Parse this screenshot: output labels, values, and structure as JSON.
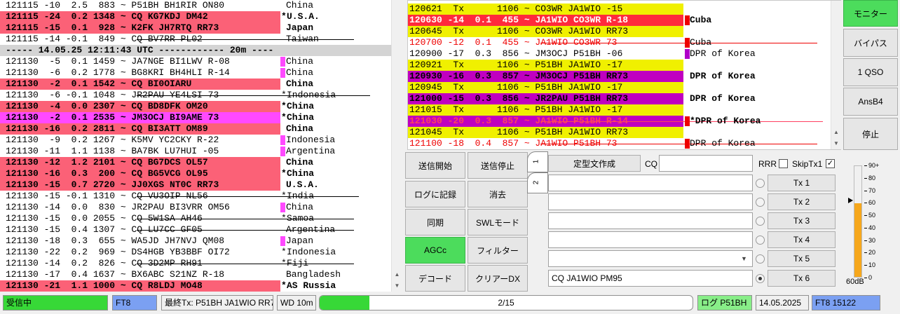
{
  "colors": {
    "cq_row": "#fb6177",
    "my_call_row": "#ff49ff",
    "tx_row": "#f0f000",
    "reply_row": "#ff2a3c",
    "dx_row": "#c000c0",
    "marker_pink": "#ff49ff",
    "marker_red": "#ee0000",
    "marker_purple": "#b000c8",
    "accent_green": "#4cdc5c"
  },
  "left_rows": [
    {
      "text": "121115 -10  2.5  883 ~ P51BH BH1RIR ON80",
      "country": "China",
      "bg": "",
      "marker": "",
      "star": "",
      "bold": false,
      "strike": false
    },
    {
      "text": "121115 -24  0.2 1348 ~ CQ KG7KDJ DM42",
      "country": "U.S.A.",
      "bg": "cq_row",
      "marker": "",
      "star": "*",
      "bold": true,
      "strike": false
    },
    {
      "text": "121115 -15  0.1  928 ~ K2FK JH7RTQ RR73",
      "country": "Japan",
      "bg": "cq_row",
      "marker": "",
      "star": "",
      "bold": true,
      "strike": false
    },
    {
      "text": "121115 -14 -0.1  849 ~ CQ BV7RR PL02",
      "country": "Taiwan",
      "bg": "",
      "marker": "",
      "star": "",
      "bold": false,
      "strike": true,
      "strike_start": 24,
      "strike_len": 13
    },
    {
      "text": "----- 14.05.25 12:11:43 UTC ------------ 20m ----",
      "country": "",
      "bg": "",
      "marker": "",
      "star": "",
      "bold": true,
      "strike": false,
      "sep": true
    },
    {
      "text": "121130  -5  0.1 1459 ~ JA7NGE BI1LWV R-08",
      "country": "China",
      "bg": "",
      "marker": "marker_pink",
      "star": "",
      "bold": false,
      "strike": false
    },
    {
      "text": "121130  -6  0.2 1778 ~ BG8KRI BH4HLI R-14",
      "country": "China",
      "bg": "",
      "marker": "marker_pink",
      "star": "",
      "bold": false,
      "strike": false
    },
    {
      "text": "121130  -2  0.1 1542 ~ CQ BI0OIARU",
      "country": "China",
      "bg": "cq_row",
      "marker": "",
      "star": "",
      "bold": true,
      "strike": false
    },
    {
      "text": "121130  -6 -0.1 1048 ~ JR2PAU YE4LSI 73",
      "country": "Indonesia",
      "bg": "",
      "marker": "",
      "star": "*",
      "bold": false,
      "strike": true,
      "strike_start": 24,
      "strike_len": 16
    },
    {
      "text": "121130  -4  0.0 2307 ~ CQ BD8DFK OM20",
      "country": "China",
      "bg": "cq_row",
      "marker": "",
      "star": "*",
      "bold": true,
      "strike": false
    },
    {
      "text": "121130  -2  0.1 2535 ~ JM3OCJ BI9AME 73",
      "country": "China",
      "bg": "my_call_row",
      "marker": "",
      "star": "*",
      "bold": true,
      "strike": false
    },
    {
      "text": "121130 -16  0.2 2811 ~ CQ BI3ATT OM89",
      "country": "China",
      "bg": "cq_row",
      "marker": "",
      "star": "",
      "bold": true,
      "strike": false
    },
    {
      "text": "121130  -9  0.2 1267 ~ K5MV YC2CKY R-22",
      "country": "Indonesia",
      "bg": "",
      "marker": "marker_pink",
      "star": "",
      "bold": false,
      "strike": false
    },
    {
      "text": "121130 -11  1.1 1138 ~ BA7BK LU7HUI -05",
      "country": "Argentina",
      "bg": "",
      "marker": "marker_pink",
      "star": "",
      "bold": false,
      "strike": false
    },
    {
      "text": "121130 -12  1.2 2101 ~ CQ BG7DCS OL57",
      "country": "China",
      "bg": "cq_row",
      "marker": "",
      "star": "",
      "bold": true,
      "strike": false
    },
    {
      "text": "121130 -16  0.3  200 ~ CQ BG5VCG OL95",
      "country": "China",
      "bg": "cq_row",
      "marker": "",
      "star": "*",
      "bold": true,
      "strike": false
    },
    {
      "text": "121130 -15  0.7 2720 ~ JJ0XGS NT0C RR73",
      "country": "U.S.A.",
      "bg": "cq_row",
      "marker": "",
      "star": "",
      "bold": true,
      "strike": false
    },
    {
      "text": "121130 -15 -0.1 1310 ~ CQ VU3OIP NL56",
      "country": "India",
      "bg": "",
      "marker": "",
      "star": "*",
      "bold": false,
      "strike": true,
      "strike_start": 24,
      "strike_len": 14
    },
    {
      "text": "121130 -14  0.0  830 ~ JR2PAU BI3VRR OM56",
      "country": "China",
      "bg": "",
      "marker": "marker_pink",
      "star": "",
      "bold": false,
      "strike": false
    },
    {
      "text": "121130 -15  0.0 2055 ~ CQ 5W1SA AH46",
      "country": "Samoa",
      "bg": "",
      "marker": "",
      "star": "*",
      "bold": false,
      "strike": true,
      "strike_start": 24,
      "strike_len": 13
    },
    {
      "text": "121130 -15  0.4 1307 ~ CQ LU7CC GF05",
      "country": "Argentina",
      "bg": "",
      "marker": "",
      "star": "",
      "bold": false,
      "strike": true,
      "strike_start": 24,
      "strike_len": 13
    },
    {
      "text": "121130 -18  0.3  655 ~ WA5JD JH7NVJ QM08",
      "country": "Japan",
      "bg": "",
      "marker": "marker_pink",
      "star": "",
      "bold": false,
      "strike": false
    },
    {
      "text": "121130 -22  0.2  969 ~ DS4HGB YB3BBF OI72",
      "country": "Indonesia",
      "bg": "",
      "marker": "",
      "star": "*",
      "bold": false,
      "strike": false
    },
    {
      "text": "121130 -14  0.2  826 ~ CQ 3D2MP RH91",
      "country": "Fiji",
      "bg": "",
      "marker": "",
      "star": "*",
      "bold": false,
      "strike": true,
      "strike_start": 24,
      "strike_len": 13
    },
    {
      "text": "121130 -17  0.4 1637 ~ BX6ABC S21NZ R-18",
      "country": "Bangladesh",
      "bg": "",
      "marker": "",
      "star": "",
      "bold": false,
      "strike": false
    },
    {
      "text": "121130 -21  1.1 1000 ~ CQ R8LDJ MO48",
      "country": "AS Russia",
      "bg": "cq_row",
      "marker": "",
      "star": "*",
      "bold": true,
      "strike": false
    }
  ],
  "rx_rows": [
    {
      "text": "120621  Tx      1106 ~ CO3WR JA1WIO -15",
      "country": "",
      "bg": "tx_row",
      "color": "#000",
      "marker": "",
      "bold": false,
      "strike": false
    },
    {
      "text": "120630 -14  0.1  455 ~ JA1WIO CO3WR R-18",
      "country": "Cuba",
      "bg": "reply_row",
      "color": "#fff",
      "marker": "marker_red",
      "bold": true,
      "strike": false
    },
    {
      "text": "120645  Tx      1106 ~ CO3WR JA1WIO RR73",
      "country": "",
      "bg": "tx_row",
      "color": "#000",
      "marker": "",
      "bold": false,
      "strike": false
    },
    {
      "text": "120700 -12  0.1  455 ~ JA1WIO CO3WR 73",
      "country": "Cuba",
      "bg": "",
      "color": "#ee0000",
      "marker": "marker_red",
      "bold": false,
      "strike": true,
      "strike_start": 24,
      "strike_len": 16
    },
    {
      "text": "120900 -17  0.3  856 ~ JM3OCJ P51BH -06",
      "country": "DPR of Korea",
      "bg": "",
      "color": "#000",
      "marker": "marker_purple",
      "bold": false,
      "strike": false
    },
    {
      "text": "120921  Tx      1106 ~ P51BH JA1WIO -17",
      "country": "",
      "bg": "tx_row",
      "color": "#000",
      "marker": "",
      "bold": false,
      "strike": false
    },
    {
      "text": "120930 -16  0.3  857 ~ JM3OCJ P51BH RR73",
      "country": "DPR of Korea",
      "bg": "dx_row",
      "color": "#000",
      "marker": "",
      "bold": true,
      "strike": false
    },
    {
      "text": "120945  Tx      1106 ~ P51BH JA1WIO -17",
      "country": "",
      "bg": "tx_row",
      "color": "#000",
      "marker": "",
      "bold": false,
      "strike": false
    },
    {
      "text": "121000 -15  0.3  856 ~ JR2PAU P51BH RR73",
      "country": "DPR of Korea",
      "bg": "dx_row",
      "color": "#000",
      "marker": "",
      "bold": true,
      "strike": false
    },
    {
      "text": "121015  Tx      1106 ~ P51BH JA1WIO -17",
      "country": "",
      "bg": "tx_row",
      "color": "#000",
      "marker": "",
      "bold": false,
      "strike": false
    },
    {
      "text": "121030 -20  0.3  857 ~ JA1WIO P51BH R-14",
      "country": "*DPR of Korea",
      "bg": "dx_row",
      "color": "#ff4060",
      "marker": "marker_red",
      "bold": true,
      "strike": true,
      "strike_start": 24,
      "strike_len": 17
    },
    {
      "text": "121045  Tx      1106 ~ P51BH JA1WIO RR73",
      "country": "",
      "bg": "tx_row",
      "color": "#000",
      "marker": "",
      "bold": false,
      "strike": false
    },
    {
      "text": "121100 -18  0.4  857 ~ JA1WIO P51BH 73",
      "country": "DPR of Korea",
      "bg": "",
      "color": "#ee0000",
      "marker": "marker_red",
      "bold": false,
      "strike": true,
      "strike_start": 24,
      "strike_len": 16
    }
  ],
  "controls": {
    "tx_enable": "送信開始",
    "tx_stop": "送信停止",
    "log_qso": "ログに記録",
    "erase": "消去",
    "sync": "同期",
    "swl_mode": "SWLモード",
    "agcc": "AGCc",
    "filter": "フィルター",
    "decode": "デコード",
    "clear_dx": "クリアーDX"
  },
  "tx_panel": {
    "tab1": "1",
    "tab2": "2",
    "gen_msgs": "定型文作成",
    "cq_label": "CQ",
    "cq_value": "",
    "rrr_label": "RRR",
    "skiptx1_label": "SkipTx1",
    "skiptx1_check": "✓",
    "tx_buttons": [
      "Tx 1",
      "Tx 2",
      "Tx 3",
      "Tx 4",
      "Tx 5",
      "Tx 6"
    ],
    "tx_fields": [
      "",
      "",
      "",
      "",
      "",
      "CQ JA1WIO PM95"
    ],
    "selected_tx": 6
  },
  "side_buttons": [
    "モニター",
    "バイパス",
    "1 QSO",
    "AnsB4",
    "停止"
  ],
  "meter": {
    "ticks": [
      "90+",
      "80",
      "70",
      "60",
      "50",
      "40",
      "30",
      "20",
      "10",
      "0"
    ],
    "level_db": 60,
    "pointer_db": 62,
    "label": "60dB"
  },
  "status": {
    "rx_state": "受信中",
    "mode": "FT8",
    "last_tx": "最終Tx: P51BH JA1WIO RR73",
    "wd": "WD 10m",
    "progress_text": "2/15",
    "progress_value": 0.133,
    "log_label": "ログ P51BH",
    "date": "14.05.2025",
    "mode_freq": "FT8  15122"
  },
  "icons": {
    "scroll_up": "▲",
    "scroll_down": "▼",
    "combo_arrow": "▼"
  }
}
